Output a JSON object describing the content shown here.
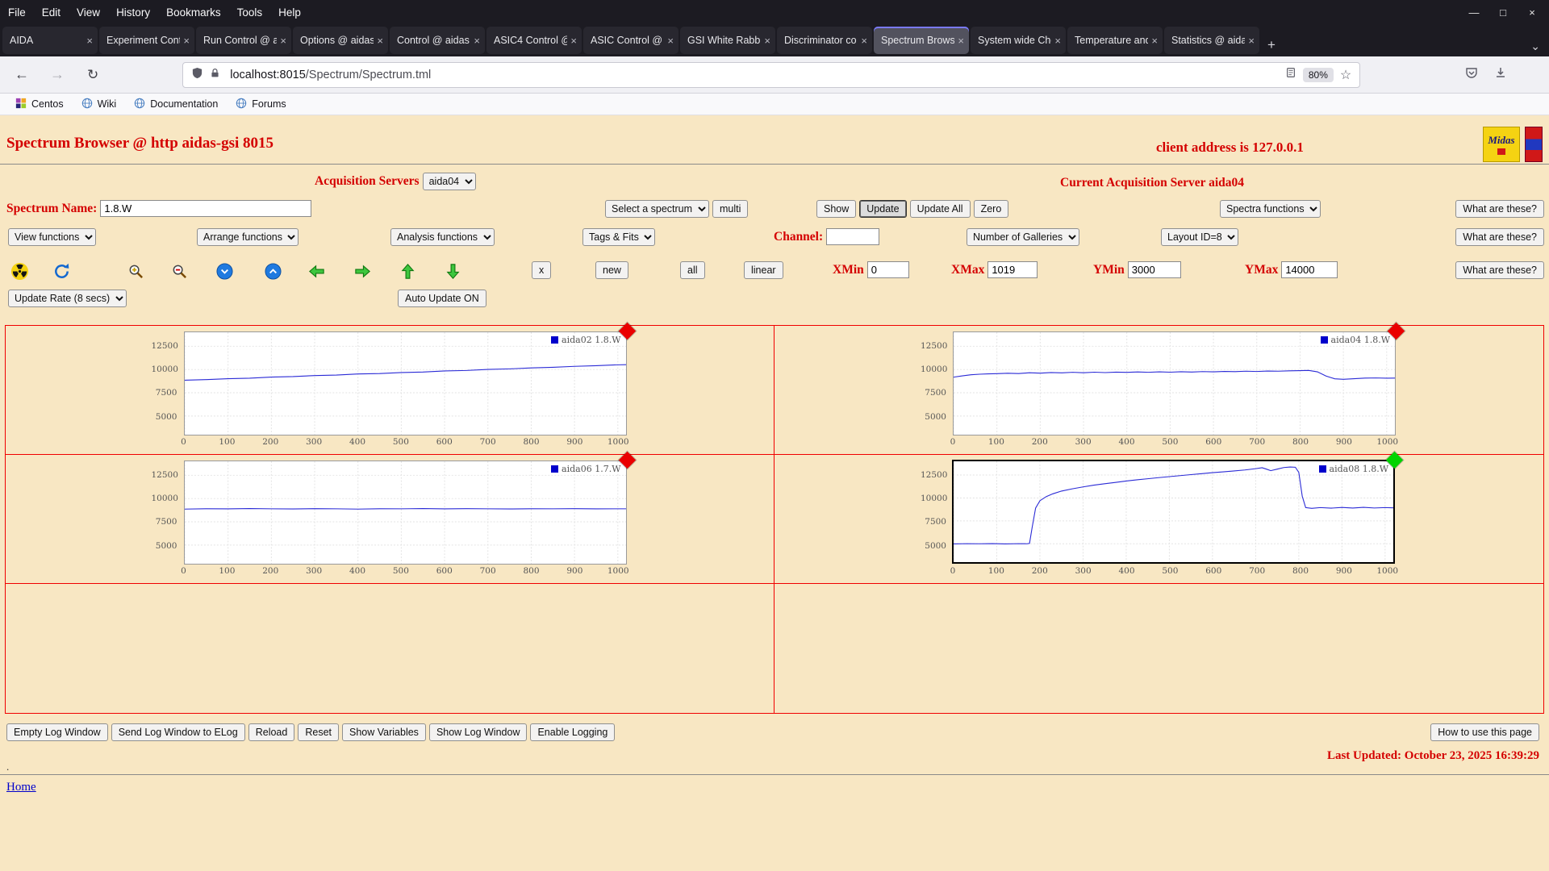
{
  "icons": {
    "back": "←",
    "forward": "→",
    "reload": "↻",
    "star": "☆",
    "minimize": "—",
    "maximize": "□",
    "close": "×",
    "new_tab": "+",
    "list_tabs": "⌄",
    "tab_close": "×"
  },
  "browser": {
    "menu": [
      "File",
      "Edit",
      "View",
      "History",
      "Bookmarks",
      "Tools",
      "Help"
    ],
    "tabs": [
      {
        "label": "AIDA",
        "active": false
      },
      {
        "label": "Experiment Cont",
        "active": false
      },
      {
        "label": "Run Control @ a",
        "active": false
      },
      {
        "label": "Options @ aidas",
        "active": false
      },
      {
        "label": "Control @ aidas",
        "active": false
      },
      {
        "label": "ASIC4 Control @",
        "active": false
      },
      {
        "label": "ASIC Control @",
        "active": false
      },
      {
        "label": "GSI White Rabbit",
        "active": false
      },
      {
        "label": "Discriminator co",
        "active": false
      },
      {
        "label": "Spectrum Brows",
        "active": true
      },
      {
        "label": "System wide Che",
        "active": false
      },
      {
        "label": "Temperature and",
        "active": false
      },
      {
        "label": "Statistics @ aida",
        "active": false
      }
    ],
    "url_domain": "localhost:8015",
    "url_path": "/Spectrum/Spectrum.tml",
    "zoom_level": "80%",
    "bookmarks": [
      "Centos",
      "Wiki",
      "Documentation",
      "Forums"
    ]
  },
  "page": {
    "title": "Spectrum Browser @ http aidas-gsi 8015",
    "client_address": "client address is 127.0.0.1",
    "midas_logo_text": "Midas",
    "servers_label": "Acquisition Servers",
    "server_selected": "aida04",
    "current_server": "Current Acquisition Server aida04",
    "spectrum_name_label": "Spectrum Name:",
    "spectrum_name_value": "1.8.W",
    "select_spectrum": "Select a spectrum",
    "multi": "multi",
    "show": "Show",
    "update": "Update",
    "update_all": "Update All",
    "zero": "Zero",
    "spectra_functions": "Spectra functions",
    "what_are_these": "What are these?",
    "view_functions": "View functions",
    "arrange_functions": "Arrange functions",
    "analysis_functions": "Analysis functions",
    "tags_fits": "Tags & Fits",
    "channel_label": "Channel:",
    "channel_value": "",
    "number_of_galleries": "Number of Galleries",
    "layout_id": "Layout ID=8",
    "x_btn": "x",
    "new_btn": "new",
    "all_btn": "all",
    "linear_btn": "linear",
    "xmin_label": "XMin",
    "xmin_value": "0",
    "xmax_label": "XMax",
    "xmax_value": "1019",
    "ymin_label": "YMin",
    "ymin_value": "3000",
    "ymax_label": "YMax",
    "ymax_value": "14000",
    "update_rate": "Update Rate (8 secs)",
    "auto_update": "Auto Update ON",
    "footer_buttons": [
      "Empty Log Window",
      "Send Log Window to ELog",
      "Reload",
      "Reset",
      "Show Variables",
      "Show Log Window",
      "Enable Logging"
    ],
    "how_to_use": "How to use this page",
    "last_updated": "Last Updated: October 23, 2025 16:39:29",
    "period": ".",
    "home": "Home"
  },
  "chart_data": [
    {
      "type": "line",
      "title": "aida02 1.8.W",
      "selected": false,
      "line_color": "#2a2ad6",
      "legend_color": "#0000cc",
      "marker_color": "#ea0000",
      "xlabel": "",
      "ylabel": "",
      "grid": true,
      "legend_position": "top-right",
      "xlim": [
        0,
        1019
      ],
      "ylim": [
        3000,
        14000
      ],
      "xticks": [
        0,
        100,
        200,
        300,
        400,
        500,
        600,
        700,
        800,
        900,
        1000
      ],
      "yticks": [
        5000,
        7500,
        10000,
        12500
      ],
      "points": [
        [
          0,
          8850
        ],
        [
          50,
          8920
        ],
        [
          100,
          9010
        ],
        [
          150,
          9070
        ],
        [
          200,
          9190
        ],
        [
          250,
          9240
        ],
        [
          300,
          9350
        ],
        [
          350,
          9400
        ],
        [
          400,
          9520
        ],
        [
          450,
          9570
        ],
        [
          500,
          9680
        ],
        [
          550,
          9730
        ],
        [
          600,
          9850
        ],
        [
          650,
          9900
        ],
        [
          700,
          10010
        ],
        [
          750,
          10070
        ],
        [
          800,
          10170
        ],
        [
          850,
          10240
        ],
        [
          900,
          10340
        ],
        [
          950,
          10410
        ],
        [
          1000,
          10500
        ],
        [
          1019,
          10520
        ]
      ]
    },
    {
      "type": "line",
      "title": "aida04 1.8.W",
      "selected": false,
      "line_color": "#2a2ad6",
      "legend_color": "#0000cc",
      "marker_color": "#ea0000",
      "xlabel": "",
      "ylabel": "",
      "grid": true,
      "legend_position": "top-right",
      "xlim": [
        0,
        1019
      ],
      "ylim": [
        3000,
        14000
      ],
      "xticks": [
        0,
        100,
        200,
        300,
        400,
        500,
        600,
        700,
        800,
        900,
        1000
      ],
      "yticks": [
        5000,
        7500,
        10000,
        12500
      ],
      "points": [
        [
          0,
          9180
        ],
        [
          20,
          9320
        ],
        [
          40,
          9440
        ],
        [
          60,
          9500
        ],
        [
          80,
          9530
        ],
        [
          100,
          9560
        ],
        [
          125,
          9600
        ],
        [
          150,
          9570
        ],
        [
          175,
          9650
        ],
        [
          200,
          9610
        ],
        [
          225,
          9680
        ],
        [
          250,
          9640
        ],
        [
          275,
          9700
        ],
        [
          300,
          9650
        ],
        [
          325,
          9710
        ],
        [
          350,
          9670
        ],
        [
          375,
          9720
        ],
        [
          400,
          9690
        ],
        [
          425,
          9740
        ],
        [
          450,
          9700
        ],
        [
          475,
          9750
        ],
        [
          500,
          9710
        ],
        [
          525,
          9760
        ],
        [
          550,
          9730
        ],
        [
          575,
          9780
        ],
        [
          600,
          9750
        ],
        [
          625,
          9800
        ],
        [
          650,
          9770
        ],
        [
          675,
          9820
        ],
        [
          700,
          9790
        ],
        [
          725,
          9840
        ],
        [
          750,
          9820
        ],
        [
          775,
          9860
        ],
        [
          800,
          9880
        ],
        [
          820,
          9900
        ],
        [
          840,
          9750
        ],
        [
          860,
          9300
        ],
        [
          880,
          9000
        ],
        [
          900,
          8950
        ],
        [
          925,
          9010
        ],
        [
          950,
          9080
        ],
        [
          975,
          9100
        ],
        [
          1000,
          9070
        ],
        [
          1019,
          9080
        ]
      ]
    },
    {
      "type": "line",
      "title": "aida06 1.7.W",
      "selected": false,
      "line_color": "#2a2ad6",
      "legend_color": "#0000cc",
      "marker_color": "#ea0000",
      "xlabel": "",
      "ylabel": "",
      "grid": true,
      "legend_position": "top-right",
      "xlim": [
        0,
        1019
      ],
      "ylim": [
        3000,
        14000
      ],
      "xticks": [
        0,
        100,
        200,
        300,
        400,
        500,
        600,
        700,
        800,
        900,
        1000
      ],
      "yticks": [
        5000,
        7500,
        10000,
        12500
      ],
      "points": [
        [
          0,
          8870
        ],
        [
          50,
          8910
        ],
        [
          100,
          8890
        ],
        [
          150,
          8930
        ],
        [
          200,
          8900
        ],
        [
          250,
          8880
        ],
        [
          300,
          8920
        ],
        [
          350,
          8900
        ],
        [
          400,
          8870
        ],
        [
          450,
          8910
        ],
        [
          500,
          8900
        ],
        [
          550,
          8930
        ],
        [
          600,
          8890
        ],
        [
          650,
          8920
        ],
        [
          700,
          8900
        ],
        [
          750,
          8880
        ],
        [
          800,
          8910
        ],
        [
          850,
          8900
        ],
        [
          900,
          8920
        ],
        [
          950,
          8890
        ],
        [
          1000,
          8900
        ],
        [
          1019,
          8900
        ]
      ]
    },
    {
      "type": "line",
      "title": "aida08 1.8.W",
      "selected": true,
      "line_color": "#2a2ad6",
      "legend_color": "#0000cc",
      "marker_color": "#00d400",
      "xlabel": "",
      "ylabel": "",
      "grid": true,
      "legend_position": "top-right",
      "xlim": [
        0,
        1019
      ],
      "ylim": [
        3000,
        14000
      ],
      "xticks": [
        0,
        100,
        200,
        300,
        400,
        500,
        600,
        700,
        800,
        900,
        1000
      ],
      "yticks": [
        5000,
        7500,
        10000,
        12500
      ],
      "points": [
        [
          0,
          4990
        ],
        [
          30,
          5010
        ],
        [
          60,
          5000
        ],
        [
          90,
          5020
        ],
        [
          120,
          4990
        ],
        [
          150,
          5010
        ],
        [
          170,
          5000
        ],
        [
          176,
          5050
        ],
        [
          182,
          6800
        ],
        [
          190,
          8900
        ],
        [
          200,
          9700
        ],
        [
          215,
          10150
        ],
        [
          230,
          10450
        ],
        [
          250,
          10750
        ],
        [
          275,
          11000
        ],
        [
          300,
          11200
        ],
        [
          325,
          11400
        ],
        [
          350,
          11550
        ],
        [
          375,
          11700
        ],
        [
          400,
          11850
        ],
        [
          425,
          11980
        ],
        [
          450,
          12100
        ],
        [
          475,
          12220
        ],
        [
          500,
          12330
        ],
        [
          525,
          12440
        ],
        [
          550,
          12550
        ],
        [
          575,
          12650
        ],
        [
          600,
          12760
        ],
        [
          625,
          12850
        ],
        [
          650,
          12950
        ],
        [
          675,
          13050
        ],
        [
          700,
          13200
        ],
        [
          715,
          13300
        ],
        [
          725,
          13150
        ],
        [
          735,
          12980
        ],
        [
          750,
          13150
        ],
        [
          765,
          13320
        ],
        [
          780,
          13380
        ],
        [
          792,
          13350
        ],
        [
          800,
          12800
        ],
        [
          808,
          10200
        ],
        [
          816,
          8950
        ],
        [
          830,
          8870
        ],
        [
          850,
          8950
        ],
        [
          875,
          8890
        ],
        [
          900,
          8970
        ],
        [
          925,
          8900
        ],
        [
          950,
          8980
        ],
        [
          975,
          8910
        ],
        [
          1000,
          8950
        ],
        [
          1019,
          8930
        ]
      ]
    }
  ]
}
